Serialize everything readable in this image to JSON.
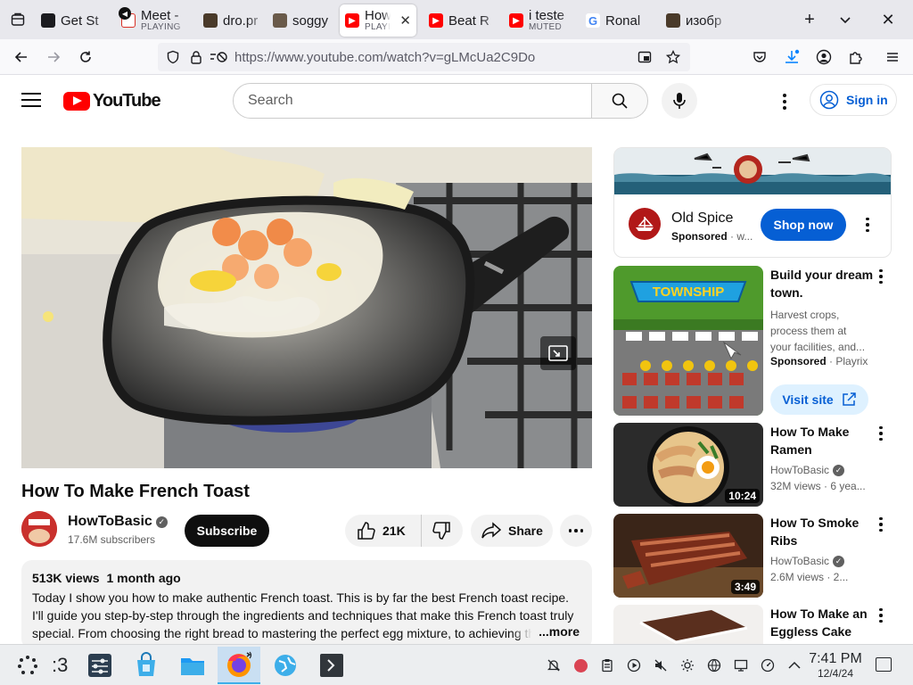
{
  "browser": {
    "tabs": [
      {
        "title": "Get St",
        "sub": "",
        "favicon": "dark-square-icon",
        "color": "#1b1b1f"
      },
      {
        "title": "Meet -",
        "sub": "PLAYING",
        "favicon": "meet-icon",
        "color": "#d93025"
      },
      {
        "title": "dro.pr",
        "sub": "",
        "favicon": "image-icon",
        "color": "#4a3a2a"
      },
      {
        "title": "soggy",
        "sub": "",
        "favicon": "image-icon",
        "color": "#6a5a4a"
      },
      {
        "title": "How",
        "sub": "PLAYING",
        "favicon": "youtube-icon",
        "color": "#ff0000",
        "active": true
      },
      {
        "title": "Beat R",
        "sub": "",
        "favicon": "youtube-icon",
        "color": "#ff0000"
      },
      {
        "title": "i teste",
        "sub": "MUTED",
        "favicon": "youtube-icon",
        "color": "#ff0000"
      },
      {
        "title": "Ronal",
        "sub": "",
        "favicon": "google-icon",
        "color": "#4285f4"
      },
      {
        "title": "изобр",
        "sub": "",
        "favicon": "image-icon",
        "color": "#4a3a2a"
      }
    ],
    "new_tab": "+",
    "url": "https://www.youtube.com/watch?v=gLMcUa2C9Do"
  },
  "youtube": {
    "logo_text": "YouTube",
    "search_placeholder": "Search",
    "sign_in": "Sign in",
    "video": {
      "title": "How To Make French Toast",
      "channel": "HowToBasic",
      "subscribers": "17.6M subscribers",
      "subscribe": "Subscribe",
      "likes": "21K",
      "share": "Share",
      "views": "513K views",
      "age": "1 month ago",
      "description": "Today I show you how to make authentic French toast. This is by far the best French toast recipe. I'll guide you step-by-step through the ingredients and techniques that make this French toast truly special. From choosing the right bread to mastering the perfect egg mixture, to achieving the",
      "more": "...more"
    },
    "ad": {
      "name": "Old Spice",
      "sponsored": "Sponsored",
      "domain": "· w...",
      "cta": "Shop now"
    },
    "recommendations": [
      {
        "title": "Build your dream town.",
        "desc": "Harvest crops, process them at your facilities, and...",
        "sponsored": "Sponsored",
        "advertiser": "· Playrix",
        "cta": "Visit site"
      },
      {
        "title": "How To Make Ramen",
        "channel": "HowToBasic",
        "views": "32M views · 6 yea...",
        "duration": "10:24"
      },
      {
        "title": "How To Smoke Ribs",
        "channel": "HowToBasic",
        "views": "2.6M views · 2...",
        "duration": "3:49"
      },
      {
        "title": "How To Make an Eggless Cake",
        "channel": "",
        "views": "",
        "duration": ""
      }
    ]
  },
  "taskbar": {
    "pager": ":3",
    "time": "7:41 PM",
    "date": "12/4/24"
  }
}
